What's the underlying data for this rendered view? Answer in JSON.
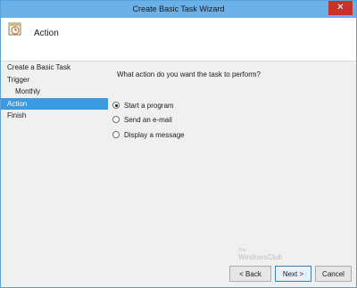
{
  "window": {
    "title": "Create Basic Task Wizard",
    "close_symbol": "✕"
  },
  "header": {
    "title": "Action",
    "icon": "task-scheduler-icon"
  },
  "nav": {
    "items": [
      {
        "label": "Create a Basic Task"
      },
      {
        "label": "Trigger"
      },
      {
        "label": "Monthly"
      },
      {
        "label": "Action"
      },
      {
        "label": "Finish"
      }
    ],
    "selected_index": 3
  },
  "content": {
    "question": "What action do you want the task to perform?",
    "options": [
      {
        "label": "Start a program",
        "selected": true
      },
      {
        "label": "Send an e-mail",
        "selected": false
      },
      {
        "label": "Display a message",
        "selected": false
      }
    ]
  },
  "watermark": {
    "line1": "The",
    "line2": "WindowsClub"
  },
  "buttons": {
    "back": "< Back",
    "next": "Next >",
    "cancel": "Cancel"
  },
  "colors": {
    "titlebar": "#6cb0e8",
    "close": "#c7332b",
    "selection": "#3b9ae0"
  }
}
